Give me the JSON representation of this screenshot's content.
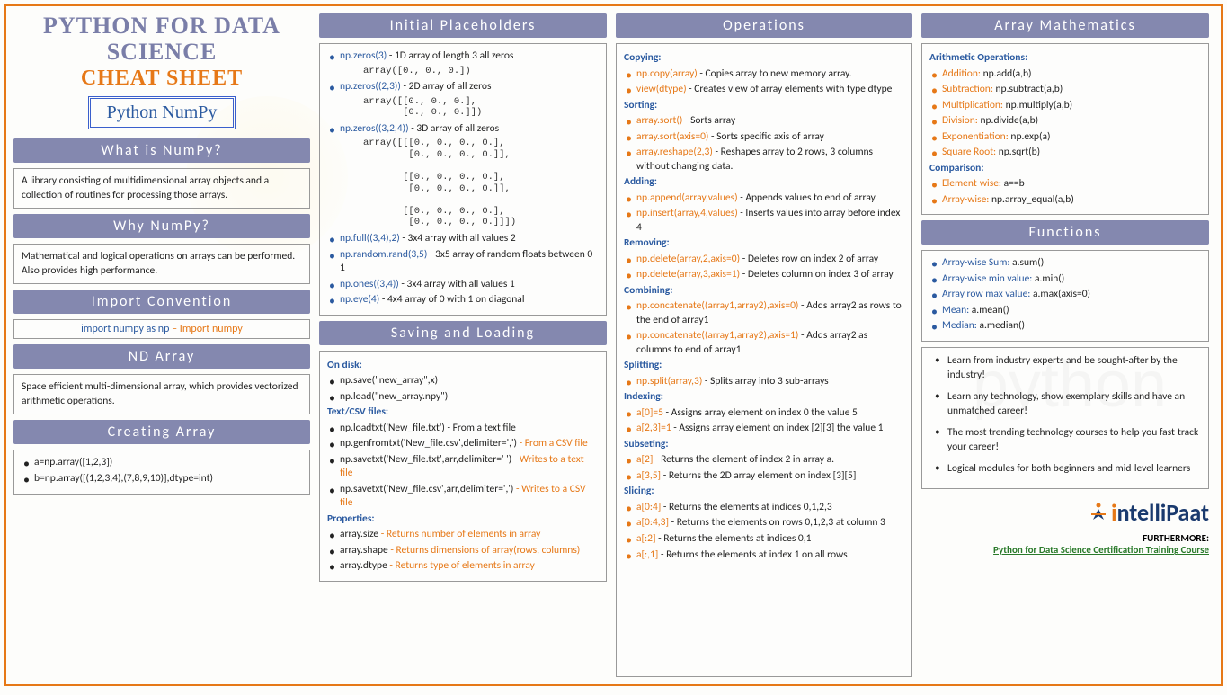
{
  "header": {
    "title_line1": "PYTHON FOR DATA",
    "title_line2": "SCIENCE",
    "title_line3": "CHEAT SHEET",
    "subtitle": "Python NumPy"
  },
  "col1": {
    "what_header": "What is NumPy?",
    "what_body": "A library consisting of multidimensional array objects and a collection of routines for processing those arrays.",
    "why_header": "Why NumPy?",
    "why_body": "Mathematical and logical operations on arrays can be performed. Also provides high performance.",
    "import_header": "Import Convention",
    "import_code": "import numpy as np",
    "import_desc": " – Import numpy",
    "nd_header": "ND Array",
    "nd_body": "Space efficient multi-dimensional array, which provides vectorized arithmetic operations.",
    "create_header": "Creating Array",
    "create_a": "a=np.array([1,2,3])",
    "create_b": "b=np.array([(1,2,3,4),(7,8,9,10)],dtype=int)"
  },
  "col2": {
    "init_header": "Initial Placeholders",
    "p1_code": "np.zeros(3)",
    "p1_desc": " - 1D array of length 3 all zeros",
    "p1_out": "array([0., 0., 0.])",
    "p2_code": "np.zeros((2,3))",
    "p2_desc": " - 2D array of all zeros",
    "p2_out": "array([[0., 0., 0.],\n       [0., 0., 0.]])",
    "p3_code": "np.zeros((3,2,4))",
    "p3_desc": " - 3D array of all zeros",
    "p3_out": "array([[[0., 0., 0., 0.],\n        [0., 0., 0., 0.]],\n\n       [[0., 0., 0., 0.],\n        [0., 0., 0., 0.]],\n\n       [[0., 0., 0., 0.],\n        [0., 0., 0., 0.]]])",
    "p4_code": "np.full((3,4),2)",
    "p4_desc": " - 3x4 array with all values 2",
    "p5_code": "np.random.rand(3,5)",
    "p5_desc": " - 3x5 array of random floats between 0-1",
    "p6_code": "np.ones((3,4))",
    "p6_desc": " - 3x4 array with all values 1",
    "p7_code": "np.eye(4)",
    "p7_desc": " - 4x4 array of 0 with 1 on diagonal",
    "save_header": "Saving and Loading",
    "disk_head": "On disk:",
    "disk1": "np.save(\"new_array\",x)",
    "disk2": "np.load(\"new_array.npy\")",
    "text_head": "Text/CSV files:",
    "t1": "np.loadtxt('New_file.txt') - From a text file",
    "t2a": "np.genfromtxt('New_file.csv',delimiter=',')",
    "t2b": " - From a CSV file",
    "t3a": "np.savetxt('New_file.txt',arr,delimiter=' ')",
    "t3b": " - Writes to a text file",
    "t4a": "np.savetxt('New_file.csv',arr,delimiter=',')",
    "t4b": " - Writes to a CSV file",
    "prop_head": "Properties:",
    "pr1a": "array.size",
    "pr1b": " - Returns number of elements in array",
    "pr2a": "array.shape",
    "pr2b": " - Returns dimensions of array(rows, columns)",
    "pr3a": "array.dtype",
    "pr3b": " - Returns type of elements in array"
  },
  "col3": {
    "ops_header": "Operations",
    "copy_head": "Copying:",
    "c1_code": "np.copy(array)",
    "c1_desc": " - Copies array to new memory array.",
    "c2_code": "view(dtype)",
    "c2_desc": " - Creates view of array elements with type dtype",
    "sort_head": "Sorting:",
    "s1_code": "array.sort()",
    "s1_desc": " - Sorts array",
    "s2_code": "array.sort(axis=0)",
    "s2_desc": " - Sorts specific axis of array",
    "s3_code": "array.reshape(2,3)",
    "s3_desc": " - Reshapes array to 2 rows, 3 columns without changing data.",
    "add_head": "Adding:",
    "a1_code": "np.append(array,values)",
    "a1_desc": " - Appends values to end of array",
    "a2_code": "np.insert(array,4,values)",
    "a2_desc": " - Inserts values into array before index 4",
    "rem_head": "Removing:",
    "r1_code": "np.delete(array,2,axis=0)",
    "r1_desc": " - Deletes row on index 2 of array",
    "r2_code": "np.delete(array,3,axis=1)",
    "r2_desc": " - Deletes column on index 3 of array",
    "comb_head": "Combining:",
    "cb1_code": "np.concatenate((array1,array2),axis=0)",
    "cb1_desc": " - Adds array2 as rows to the end of array1",
    "cb2_code": "np.concatenate((array1,array2),axis=1)",
    "cb2_desc": " - Adds array2 as columns to end of array1",
    "split_head": "Splitting:",
    "sp1_code": "np.split(array,3)",
    "sp1_desc": " - Splits array into 3 sub-arrays",
    "idx_head": "Indexing:",
    "i1_code": "a[0]=5",
    "i1_desc": " - Assigns array element on index 0 the value 5",
    "i2_code": "a[2,3]=1",
    "i2_desc": " - Assigns array element on index [2][3] the value 1",
    "sub_head": "Subseting:",
    "su1_code": "a[2]",
    "su1_desc": " - Returns the element of index 2 in array a.",
    "su2_code": "a[3,5]",
    "su2_desc": " - Returns the 2D array element on index [3][5]",
    "slice_head": "Slicing:",
    "sl1_code": "a[0:4]",
    "sl1_desc": " - Returns the elements at indices 0,1,2,3",
    "sl2_code": "a[0:4,3]",
    "sl2_desc": " - Returns the elements on rows 0,1,2,3 at column 3",
    "sl3_code": "a[:2]",
    "sl3_desc": " - Returns the elements at indices 0,1",
    "sl4_code": "a[:,1]",
    "sl4_desc": " - Returns the elements at index 1 on all rows"
  },
  "col4": {
    "math_header": "Array Mathematics",
    "arith_head": "Arithmetic Operations:",
    "m1_l": "Addition:",
    "m1_r": " np.add(a,b)",
    "m2_l": "Subtraction:",
    "m2_r": " np.subtract(a,b)",
    "m3_l": "Multiplication:",
    "m3_r": "  np.multiply(a,b)",
    "m4_l": "Division:",
    "m4_r": " np.divide(a,b)",
    "m5_l": "Exponentiation:",
    "m5_r": " np.exp(a)",
    "m6_l": "Square Root:",
    "m6_r": " np.sqrt(b)",
    "comp_head": "Comparison:",
    "cp1_l": "Element-wise:",
    "cp1_r": " a==b",
    "cp2_l": "Array-wise:",
    "cp2_r": " np.array_equal(a,b)",
    "func_header": "Functions",
    "f1_l": "Array-wise Sum:",
    "f1_r": " a.sum()",
    "f2_l": "Array-wise min value:",
    "f2_r": " a.min()",
    "f3_l": "Array row max value:",
    "f3_r": "  a.max(axis=0)",
    "f4_l": "Mean:",
    "f4_r": " a.mean()",
    "f5_l": "Median:",
    "f5_r": " a.median()",
    "mk1": "Learn from industry experts and be sought-after by the industry!",
    "mk2": "Learn any technology, show exemplary skills and have an unmatched career!",
    "mk3": "The most trending technology courses to help you fast-track your career!",
    "mk4": "Logical modules for both beginners and mid-level learners",
    "logo_text_i": "i",
    "logo_text_rest": "ntelliPaat",
    "furthermore": "FURTHERMORE:",
    "course_link": "Python for Data Science Certification Training Course"
  },
  "watermark": "python"
}
